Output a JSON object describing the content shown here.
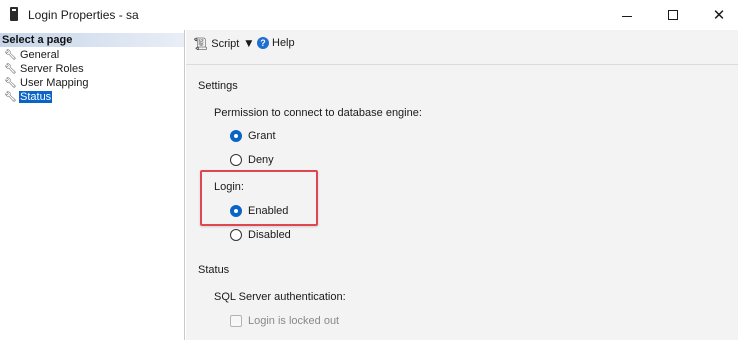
{
  "window": {
    "title": "Login Properties - sa",
    "controls": {
      "minimize": "minimize",
      "maximize": "maximize",
      "close": "✕"
    }
  },
  "sidebar": {
    "header": "Select a page",
    "items": [
      {
        "label": "General",
        "selected": false
      },
      {
        "label": "Server Roles",
        "selected": false
      },
      {
        "label": "User Mapping",
        "selected": false
      },
      {
        "label": "Status",
        "selected": true
      }
    ]
  },
  "toolbar": {
    "script_label": "Script",
    "help_label": "Help",
    "help_icon": "?"
  },
  "settings": {
    "section_title": "Settings",
    "permission_label": "Permission to connect to database engine:",
    "permission_options": [
      {
        "label": "Grant",
        "checked": true
      },
      {
        "label": "Deny",
        "checked": false
      }
    ],
    "login_label": "Login:",
    "login_options": [
      {
        "label": "Enabled",
        "checked": true
      },
      {
        "label": "Disabled",
        "checked": false
      }
    ]
  },
  "status": {
    "section_title": "Status",
    "auth_label": "SQL Server authentication:",
    "locked_out_label": "Login is locked out",
    "locked_out_checked": false,
    "locked_out_enabled": false
  },
  "colors": {
    "selection": "#0a64c8",
    "highlight_box": "#e0464f",
    "panel_bg": "#f3f3f3"
  }
}
